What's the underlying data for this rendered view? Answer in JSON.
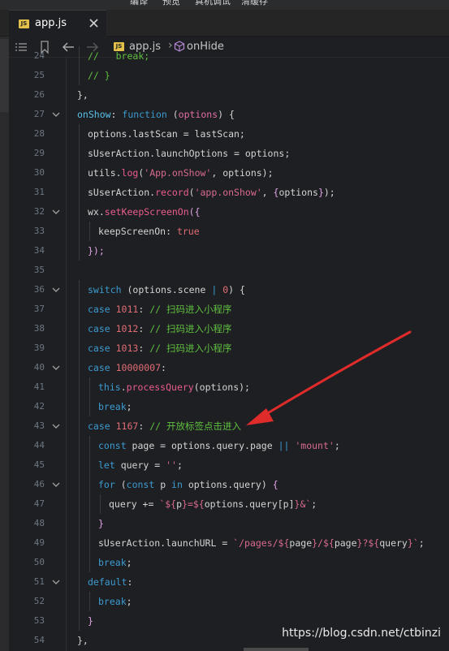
{
  "menubar": {
    "items": [
      "编译",
      "预览",
      "真机调试",
      "清缓存"
    ]
  },
  "tab": {
    "file_badge": "JS",
    "name": "app.js",
    "close_icon": "close-icon"
  },
  "breadcrumb": {
    "file_badge": "JS",
    "file": "app.js",
    "separator": "›",
    "symbol": "onHide"
  },
  "editor": {
    "lines": [
      {
        "no": "24",
        "indent": 1,
        "tokens": [
          {
            "t": "// ",
            "c": "comment"
          },
          {
            "t": "  break;",
            "c": "comment"
          }
        ]
      },
      {
        "no": "25",
        "indent": 1,
        "tokens": [
          {
            "t": "// }",
            "c": "comment"
          }
        ]
      },
      {
        "no": "26",
        "indent": 0,
        "tokens": [
          {
            "t": "},",
            "c": "punc"
          }
        ]
      },
      {
        "no": "27",
        "indent": 0,
        "fold": true,
        "tokens": [
          {
            "t": "onShow",
            "c": "fn"
          },
          {
            "t": ": ",
            "c": "plain"
          },
          {
            "t": "function",
            "c": "kw"
          },
          {
            "t": " (",
            "c": "plain"
          },
          {
            "t": "options",
            "c": "param"
          },
          {
            "t": ") {",
            "c": "plain"
          }
        ]
      },
      {
        "no": "28",
        "indent": 1,
        "tokens": [
          {
            "t": "options.lastScan = lastScan;",
            "c": "plain"
          }
        ]
      },
      {
        "no": "29",
        "indent": 1,
        "tokens": [
          {
            "t": "sUserAction.launchOptions = options;",
            "c": "plain"
          }
        ]
      },
      {
        "no": "30",
        "indent": 1,
        "tokens": [
          {
            "t": "utils.",
            "c": "plain"
          },
          {
            "t": "log",
            "c": "method"
          },
          {
            "t": "(",
            "c": "plain"
          },
          {
            "t": "'App.onShow'",
            "c": "str"
          },
          {
            "t": ", options);",
            "c": "plain"
          }
        ]
      },
      {
        "no": "31",
        "indent": 1,
        "tokens": [
          {
            "t": "sUserAction.",
            "c": "plain"
          },
          {
            "t": "record",
            "c": "method"
          },
          {
            "t": "(",
            "c": "plain"
          },
          {
            "t": "'app.onShow'",
            "c": "str"
          },
          {
            "t": ", ",
            "c": "plain"
          },
          {
            "t": "{",
            "c": "brace"
          },
          {
            "t": "options",
            "c": "plain"
          },
          {
            "t": "}",
            "c": "brace"
          },
          {
            "t": ");",
            "c": "plain"
          }
        ]
      },
      {
        "no": "32",
        "indent": 1,
        "fold": true,
        "tokens": [
          {
            "t": "wx.",
            "c": "plain"
          },
          {
            "t": "setKeepScreenOn",
            "c": "method"
          },
          {
            "t": "({",
            "c": "brace"
          }
        ]
      },
      {
        "no": "33",
        "indent": 2,
        "tokens": [
          {
            "t": "keepScreenOn: ",
            "c": "plain"
          },
          {
            "t": "true",
            "c": "num"
          }
        ]
      },
      {
        "no": "34",
        "indent": 1,
        "tokens": [
          {
            "t": "});",
            "c": "brace"
          }
        ]
      },
      {
        "no": "35",
        "indent": 0,
        "tokens": []
      },
      {
        "no": "36",
        "indent": 1,
        "fold": true,
        "tokens": [
          {
            "t": "switch",
            "c": "kw"
          },
          {
            "t": " (options.scene ",
            "c": "plain"
          },
          {
            "t": "|",
            "c": "kw"
          },
          {
            "t": " ",
            "c": "plain"
          },
          {
            "t": "0",
            "c": "num"
          },
          {
            "t": ") {",
            "c": "plain"
          }
        ]
      },
      {
        "no": "37",
        "indent": 1,
        "tokens": [
          {
            "t": "case ",
            "c": "kw"
          },
          {
            "t": "1011",
            "c": "num"
          },
          {
            "t": ": ",
            "c": "plain"
          },
          {
            "t": "// 扫码进入小程序",
            "c": "comment"
          }
        ]
      },
      {
        "no": "38",
        "indent": 1,
        "tokens": [
          {
            "t": "case ",
            "c": "kw"
          },
          {
            "t": "1012",
            "c": "num"
          },
          {
            "t": ": ",
            "c": "plain"
          },
          {
            "t": "// 扫码进入小程序",
            "c": "comment"
          }
        ]
      },
      {
        "no": "39",
        "indent": 1,
        "tokens": [
          {
            "t": "case ",
            "c": "kw"
          },
          {
            "t": "1013",
            "c": "num"
          },
          {
            "t": ": ",
            "c": "plain"
          },
          {
            "t": "// 扫码进入小程序",
            "c": "comment"
          }
        ]
      },
      {
        "no": "40",
        "indent": 1,
        "fold": true,
        "tokens": [
          {
            "t": "case ",
            "c": "kw"
          },
          {
            "t": "10000007",
            "c": "num"
          },
          {
            "t": ":",
            "c": "plain"
          }
        ]
      },
      {
        "no": "41",
        "indent": 2,
        "tokens": [
          {
            "t": "this",
            "c": "kw"
          },
          {
            "t": ".",
            "c": "plain"
          },
          {
            "t": "processQuery",
            "c": "method"
          },
          {
            "t": "(options);",
            "c": "plain"
          }
        ]
      },
      {
        "no": "42",
        "indent": 2,
        "tokens": [
          {
            "t": "break",
            "c": "kw"
          },
          {
            "t": ";",
            "c": "plain"
          }
        ]
      },
      {
        "no": "43",
        "indent": 1,
        "fold": true,
        "tokens": [
          {
            "t": "case ",
            "c": "kw"
          },
          {
            "t": "1167",
            "c": "num"
          },
          {
            "t": ": ",
            "c": "plain"
          },
          {
            "t": "// 开放标签点击进入",
            "c": "comment"
          }
        ]
      },
      {
        "no": "44",
        "indent": 2,
        "tokens": [
          {
            "t": "const",
            "c": "kw"
          },
          {
            "t": " page = options.query.page ",
            "c": "plain"
          },
          {
            "t": "||",
            "c": "kw"
          },
          {
            "t": " ",
            "c": "plain"
          },
          {
            "t": "'mount'",
            "c": "str"
          },
          {
            "t": ";",
            "c": "plain"
          }
        ]
      },
      {
        "no": "45",
        "indent": 2,
        "tokens": [
          {
            "t": "let",
            "c": "kw"
          },
          {
            "t": " query = ",
            "c": "plain"
          },
          {
            "t": "''",
            "c": "str"
          },
          {
            "t": ";",
            "c": "plain"
          }
        ]
      },
      {
        "no": "46",
        "indent": 2,
        "fold": true,
        "tokens": [
          {
            "t": "for",
            "c": "kw"
          },
          {
            "t": " (",
            "c": "plain"
          },
          {
            "t": "const",
            "c": "kw"
          },
          {
            "t": " p ",
            "c": "plain"
          },
          {
            "t": "in",
            "c": "kw"
          },
          {
            "t": " options.query) ",
            "c": "plain"
          },
          {
            "t": "{",
            "c": "brace"
          }
        ]
      },
      {
        "no": "47",
        "indent": 3,
        "tokens": [
          {
            "t": "query += ",
            "c": "plain"
          },
          {
            "t": "`${",
            "c": "str"
          },
          {
            "t": "p",
            "c": "plain"
          },
          {
            "t": "}=${",
            "c": "str"
          },
          {
            "t": "options.query[p]",
            "c": "plain"
          },
          {
            "t": "}&`",
            "c": "str"
          },
          {
            "t": ";",
            "c": "plain"
          }
        ]
      },
      {
        "no": "48",
        "indent": 2,
        "tokens": [
          {
            "t": "}",
            "c": "brace"
          }
        ]
      },
      {
        "no": "49",
        "indent": 2,
        "tokens": [
          {
            "t": "sUserAction.launchURL = ",
            "c": "plain"
          },
          {
            "t": "`/pages/${",
            "c": "str"
          },
          {
            "t": "page",
            "c": "plain"
          },
          {
            "t": "}/${",
            "c": "str"
          },
          {
            "t": "page",
            "c": "plain"
          },
          {
            "t": "}?${",
            "c": "str"
          },
          {
            "t": "query",
            "c": "plain"
          },
          {
            "t": "}`",
            "c": "str"
          },
          {
            "t": ";",
            "c": "plain"
          }
        ]
      },
      {
        "no": "50",
        "indent": 2,
        "tokens": [
          {
            "t": "break",
            "c": "kw"
          },
          {
            "t": ";",
            "c": "plain"
          }
        ]
      },
      {
        "no": "51",
        "indent": 1,
        "fold": true,
        "tokens": [
          {
            "t": "default",
            "c": "kw"
          },
          {
            "t": ":",
            "c": "plain"
          }
        ]
      },
      {
        "no": "52",
        "indent": 2,
        "tokens": [
          {
            "t": "break",
            "c": "kw"
          },
          {
            "t": ";",
            "c": "plain"
          }
        ]
      },
      {
        "no": "53",
        "indent": 1,
        "tokens": [
          {
            "t": "}",
            "c": "brace"
          }
        ]
      },
      {
        "no": "54",
        "indent": 0,
        "tokens": [
          {
            "t": "},",
            "c": "punc"
          }
        ]
      }
    ]
  },
  "colors": {
    "plain": "#d4d4d4",
    "kw": "#3c9bd0",
    "fn": "#58c0e8",
    "param": "#e06fa6",
    "method": "#ea5c8e",
    "str": "#d96a8e",
    "num": "#e06c75",
    "comment": "#5fbf3f",
    "brace": "#e0a4e6",
    "punc": "#d4d4d4",
    "arrow": "#e02b2b"
  },
  "annotation": {
    "type": "arrow",
    "points_to": "case 1167 line"
  },
  "watermark": "https://blog.csdn.net/ctbinzi"
}
